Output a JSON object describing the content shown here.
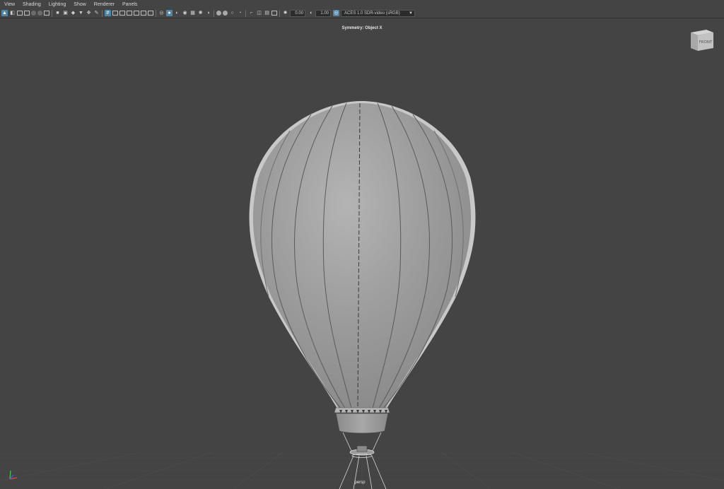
{
  "menubar": {
    "items": [
      "View",
      "Shading",
      "Lighting",
      "Show",
      "Renderer",
      "Panels"
    ]
  },
  "toolbar": {
    "exposure_value": "0.00",
    "gamma_value": "1.00",
    "color_space": "ACES 1.0 SDR-video (sRGB)",
    "icons": [
      "select-camera-icon",
      "camera-attributes-icon",
      "bookmark-icon",
      "image-plane-icon",
      "grid-icon",
      "film-gate-icon",
      "resolution-gate-icon",
      "safe-action-icon",
      "wireframe-icon",
      "smooth-shade-icon",
      "textured-icon",
      "lights-icon",
      "shadows-icon",
      "isolate-icon",
      "xray-icon",
      "exposure-icon",
      "gamma-icon",
      "color-management-icon"
    ]
  },
  "viewport": {
    "symmetry_label": "Symmetry: Object X",
    "camera_label": "persp",
    "viewcube_face": "FRONT"
  },
  "colors": {
    "background": "#444444",
    "accent": "#5285a6",
    "model": "#9a9a9a"
  }
}
